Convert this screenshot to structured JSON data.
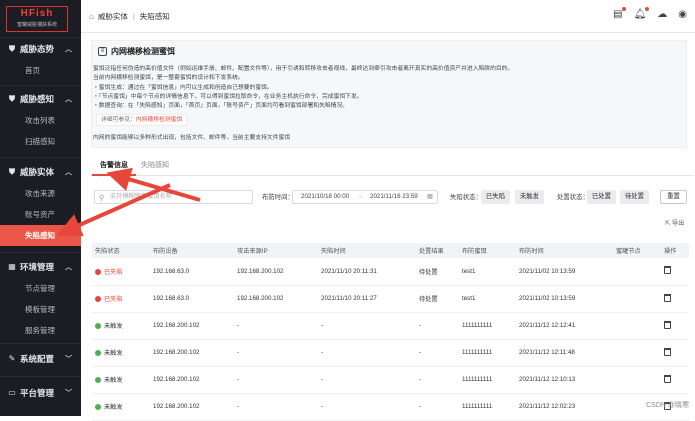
{
  "app": {
    "logo_title": "HFish",
    "logo_subtitle": "蜜罐威胁捕获系统"
  },
  "sidebar": [
    {
      "title": "威胁态势",
      "items": [
        {
          "label": "首页"
        }
      ]
    },
    {
      "title": "威胁感知",
      "items": [
        {
          "label": "攻击列表"
        },
        {
          "label": "扫描感知"
        }
      ]
    },
    {
      "title": "威胁实体",
      "items": [
        {
          "label": "攻击来源"
        },
        {
          "label": "账号资产"
        },
        {
          "label": "失陷感知",
          "active": true
        }
      ]
    },
    {
      "title": "环境管理",
      "items": [
        {
          "label": "节点管理"
        },
        {
          "label": "模板管理"
        },
        {
          "label": "服务管理"
        }
      ]
    },
    {
      "title": "系统配置",
      "items": []
    },
    {
      "title": "平台管理",
      "items": []
    }
  ],
  "breadcrumb": {
    "parent": "威胁实体",
    "current": "失陷感知"
  },
  "info": {
    "title": "内网横移检测蜜饵",
    "lines": [
      "蜜饵泛指任何伪造的高价值文件（例如运维手册、邮件、配置文件等），用于引诱和转移攻击者视线，最终达到牵引攻击者离开真实的高价值资产并进入陷阱的目的。",
      "当前内网横移检测蜜饵，是一整套蜜饵的设计和下发系统。",
      "・蜜饵生成：通过在「蜜饵信息」内可以生成和创造自己想要的蜜饵。",
      "・「节点蜜饵」中每个节点的详情信息下，可以得到蜜饵拉取命令，在业务主机执行命令，完成蜜饵下发。",
      "・数据查询：在「失陷感知」页面，「首页」页面，「账号资产」页面均可看到蜜饵部署和失陷情况。"
    ],
    "ref_prefix": "详细可参见：",
    "ref_link": "内网横移检测蜜饵",
    "last": "内网的蜜饵能够以多种形式出现，包括文件、邮件等，当前主要支持文件蜜饵"
  },
  "tabs": [
    {
      "label": "告警信息",
      "active": true
    },
    {
      "label": "失陷感知",
      "active": false
    }
  ],
  "filters": {
    "search_placeholder": "支持模糊搜索蜜饵名称",
    "time_label": "布防时间：",
    "time_start": "2021/10/18 00:00",
    "time_sep": "→",
    "time_end": "2021/11/16 23:59",
    "fall_label": "失陷状态：",
    "fall_options": [
      "已失陷",
      "未触发"
    ],
    "deploy_label": "处置状态：",
    "deploy_options": [
      "已处置",
      "待处置"
    ],
    "reset": "重置",
    "export": "导出"
  },
  "table": {
    "columns": [
      "失陷状态",
      "布防设备",
      "攻击来源IP",
      "失陷时间",
      "处置结果",
      "布防蜜饵",
      "布防时间",
      "蜜罐节点",
      "操作"
    ],
    "rows": [
      [
        "已失陷",
        "192.168.63.0",
        "192.168.200.102",
        "2021/11/10 20:11:31",
        "待处置",
        "test1",
        "2021/11/02 10:13:59",
        ""
      ],
      [
        "已失陷",
        "192.168.63.0",
        "192.168.200.102",
        "2021/11/10 20:11:27",
        "待处置",
        "test1",
        "2021/11/02 10:13:59",
        ""
      ],
      [
        "未触发",
        "192.168.200.102",
        "-",
        "-",
        "-",
        "1111111111",
        "2021/11/12 12:12:41",
        ""
      ],
      [
        "未触发",
        "192.168.200.102",
        "-",
        "-",
        "-",
        "1111111111",
        "2021/11/12 12:11:48",
        ""
      ],
      [
        "未触发",
        "192.168.200.102",
        "-",
        "-",
        "-",
        "1111111111",
        "2021/11/12 12:10:13",
        ""
      ],
      [
        "未触发",
        "192.168.200.102",
        "-",
        "-",
        "-",
        "1111111111",
        "2021/11/12 12:02:23",
        ""
      ]
    ]
  },
  "colors": {
    "accent": "#e8463a",
    "sidebar_bg": "#1c1c24",
    "fallen": "#e8463a",
    "untriggered": "#4caf50"
  },
  "watermark": "CSDN @晓寒"
}
